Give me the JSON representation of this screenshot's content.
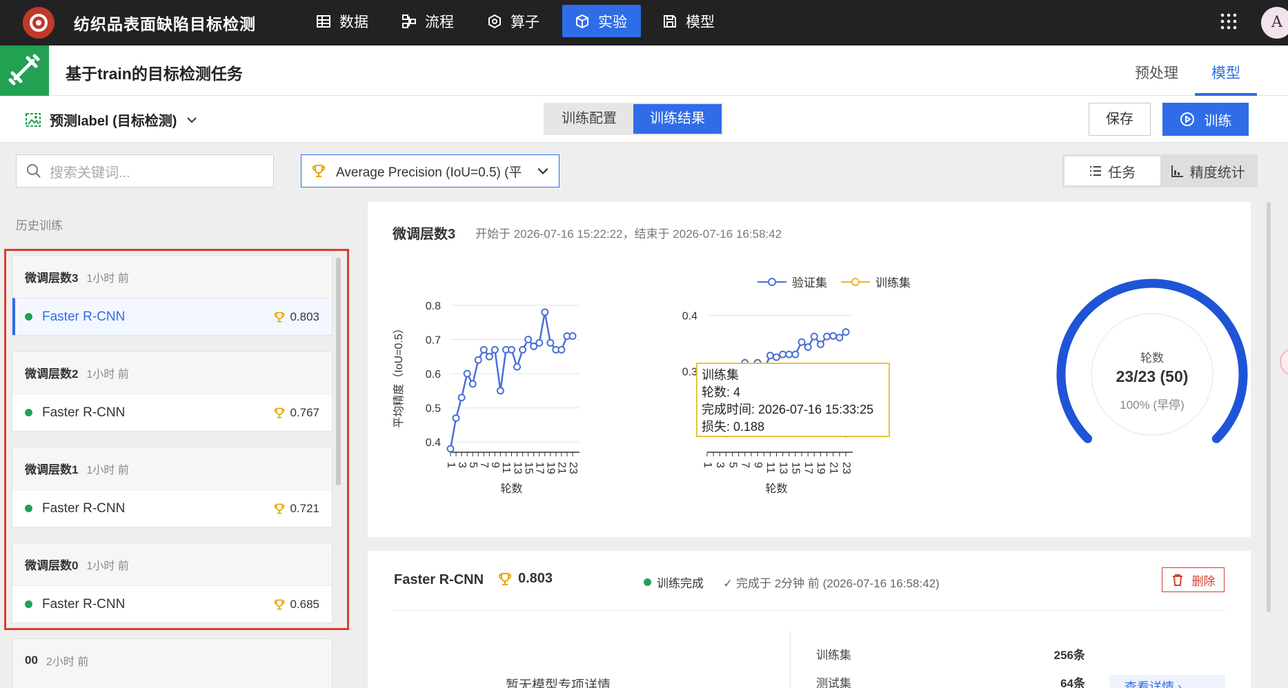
{
  "app": {
    "title": "纺织品表面缺陷目标检测"
  },
  "nav": [
    {
      "label": "数据",
      "icon": "table-icon",
      "active": false
    },
    {
      "label": "流程",
      "icon": "flow-icon",
      "active": false
    },
    {
      "label": "算子",
      "icon": "operator-icon",
      "active": false
    },
    {
      "label": "实验",
      "icon": "cube-icon",
      "active": true
    },
    {
      "label": "模型",
      "icon": "save-icon",
      "active": false
    }
  ],
  "user": {
    "avatar": "A"
  },
  "task": {
    "title": "基于train的目标检测任务",
    "tabs": [
      {
        "label": "预处理",
        "active": false
      },
      {
        "label": "模型",
        "active": true
      }
    ]
  },
  "toolbar": {
    "prediction": "预测label (目标检测)",
    "seg": [
      {
        "label": "训练配置",
        "active": false
      },
      {
        "label": "训练结果",
        "active": true
      }
    ],
    "save_label": "保存",
    "train_label": "训练"
  },
  "filters": {
    "search_placeholder": "搜索关键词...",
    "metric": "Average Precision (IoU=0.5) (平",
    "view": [
      {
        "label": "任务",
        "active": true
      },
      {
        "label": "精度统计",
        "active": false
      }
    ]
  },
  "history": {
    "label": "历史训练",
    "groups": [
      {
        "name": "微调层数3",
        "time": "1小时 前",
        "model": "Faster R-CNN",
        "score": "0.803",
        "selected": true
      },
      {
        "name": "微调层数2",
        "time": "1小时 前",
        "model": "Faster R-CNN",
        "score": "0.767",
        "selected": false
      },
      {
        "name": "微调层数1",
        "time": "1小时 前",
        "model": "Faster R-CNN",
        "score": "0.721",
        "selected": false
      },
      {
        "name": "微调层数0",
        "time": "1小时 前",
        "model": "Faster R-CNN",
        "score": "0.685",
        "selected": false
      },
      {
        "name": "00",
        "time": "2小时 前"
      }
    ]
  },
  "run": {
    "title": "微调层数3",
    "period": "开始于  2026-07-16 15:22:22，结束于  2026-07-16 16:58:42"
  },
  "chart_data": [
    {
      "type": "line",
      "ylabel": "平均精度（IoU=0.5）",
      "xlabel": "轮数",
      "ylim": [
        0.37,
        0.82
      ],
      "yticks": [
        "0.4",
        "0.5",
        "0.6",
        "0.7",
        "0.8"
      ],
      "xticks": [
        "1",
        "3",
        "5",
        "7",
        "9",
        "11",
        "13",
        "15",
        "17",
        "19",
        "21",
        "23"
      ],
      "x": [
        1,
        2,
        3,
        4,
        5,
        6,
        7,
        8,
        9,
        10,
        11,
        12,
        13,
        14,
        15,
        16,
        17,
        18,
        19,
        20,
        21,
        22,
        23
      ],
      "series": [
        {
          "values": [
            0.38,
            0.47,
            0.53,
            0.6,
            0.57,
            0.64,
            0.67,
            0.65,
            0.67,
            0.55,
            0.67,
            0.67,
            0.62,
            0.67,
            0.7,
            0.68,
            0.69,
            0.78,
            0.69,
            0.67,
            0.67,
            0.71,
            0.71
          ],
          "color": "#4a6fd8"
        }
      ]
    },
    {
      "type": "line",
      "xlabel": "轮数",
      "ylim": [
        0.155,
        0.43
      ],
      "yticks": [
        "0.4",
        "0.3"
      ],
      "xticks": [
        "1",
        "3",
        "5",
        "7",
        "9",
        "11",
        "13",
        "15",
        "17",
        "19",
        "21",
        "23"
      ],
      "x": [
        1,
        2,
        3,
        4,
        5,
        6,
        7,
        8,
        9,
        10,
        11,
        12,
        13,
        14,
        15,
        16,
        17,
        18,
        19,
        20,
        21,
        22,
        23
      ],
      "series": [
        {
          "name": "验证集",
          "color": "#4a6fd8",
          "values": [
            0.272,
            0.28,
            0.305,
            0.304,
            0.302,
            0.305,
            0.315,
            0.308,
            0.315,
            0.302,
            0.328,
            0.325,
            0.33,
            0.33,
            0.33,
            0.352,
            0.343,
            0.362,
            0.348,
            0.362,
            0.363,
            0.36,
            0.37
          ]
        },
        {
          "name": "训练集",
          "color": "#e8b72c",
          "values": [
            0.305,
            0.26,
            0.235,
            0.188,
            0.215,
            0.21,
            0.207,
            0.205,
            0.203,
            0.202,
            0.201,
            0.2,
            0.199,
            0.199,
            0.199,
            0.198,
            0.198,
            0.196,
            0.194,
            0.193,
            0.192,
            0.19,
            0.188
          ]
        }
      ]
    }
  ],
  "tooltip": {
    "lines": [
      "训练集",
      "轮数: 4",
      "完成时间: 2026-07-16 15:33:25",
      "损失: 0.188"
    ]
  },
  "gauge": {
    "label": "轮数",
    "value": "23/23 (50)",
    "sub": "100% (早停)",
    "fraction": 1.0
  },
  "detail": {
    "model": "Faster R-CNN",
    "score": "0.803",
    "status": "训练完成",
    "done": "✓  完成于 2分钟 前 (2026-07-16 16:58:42)",
    "delete_label": "删除",
    "empty": "暂无模型专项详情",
    "rows": [
      {
        "label": "训练集",
        "value": "256条"
      },
      {
        "label": "测试集",
        "value": "64条"
      }
    ],
    "more_label": "查看详情 ›"
  }
}
